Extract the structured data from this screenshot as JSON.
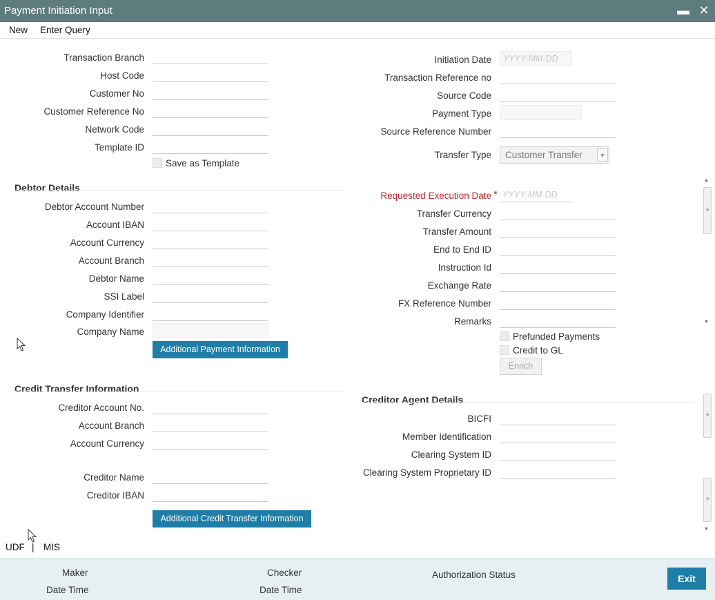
{
  "window": {
    "title": "Payment Initiation Input",
    "minimize": "▬",
    "close": "✕"
  },
  "menu": {
    "new": "New",
    "enter_query": "Enter Query"
  },
  "header_left": {
    "transaction_branch": "Transaction Branch",
    "host_code": "Host Code",
    "customer_no": "Customer No",
    "customer_reference_no": "Customer Reference No",
    "network_code": "Network Code",
    "template_id": "Template ID",
    "save_as_template": "Save as Template"
  },
  "header_right": {
    "initiation_date": "Initiation Date",
    "date_placeholder": "YYYY-MM-DD",
    "transaction_reference_no": "Transaction Reference no",
    "source_code": "Source Code",
    "payment_type": "Payment Type",
    "source_reference_number": "Source Reference Number",
    "transfer_type": "Transfer Type",
    "transfer_type_value": "Customer Transfer"
  },
  "debtor": {
    "section_title": "Debtor Details",
    "debtor_account_number": "Debtor Account Number",
    "account_iban": "Account IBAN",
    "account_currency": "Account Currency",
    "account_branch": "Account Branch",
    "debtor_name": "Debtor Name",
    "ssi_label": "SSI Label",
    "company_identifier": "Company Identifier",
    "company_name": "Company Name",
    "additional_payment_info_button": "Additional Payment Information"
  },
  "transfer": {
    "requested_execution_date": "Requested Execution Date",
    "required_marker": "*",
    "date_placeholder": "YYYY-MM-DD",
    "transfer_currency": "Transfer Currency",
    "transfer_amount": "Transfer Amount",
    "end_to_end_id": "End to End ID",
    "instruction_id": "Instruction Id",
    "exchange_rate": "Exchange Rate",
    "fx_reference_number": "FX Reference Number",
    "remarks": "Remarks",
    "prefunded_payments": "Prefunded Payments",
    "credit_to_gl": "Credit to GL",
    "enrich_button": "Enrich"
  },
  "credit_transfer": {
    "section_title": "Credit Transfer Information",
    "creditor_account_no": "Creditor Account No.",
    "account_branch": "Account Branch",
    "account_currency": "Account Currency",
    "creditor_name": "Creditor Name",
    "creditor_iban": "Creditor IBAN",
    "additional_credit_info_button": "Additional Credit Transfer Information"
  },
  "creditor_agent": {
    "section_title": "Creditor Agent Details",
    "bicfi": "BICFI",
    "member_identification": "Member Identification",
    "clearing_system_id": "Clearing System ID",
    "clearing_system_proprietary_id": "Clearing System Proprietary ID"
  },
  "tabs": {
    "udf": "UDF",
    "separator": "|",
    "mis": "MIS"
  },
  "footer": {
    "maker": "Maker",
    "maker_date_time": "Date Time",
    "checker": "Checker",
    "checker_date_time": "Date Time",
    "authorization_status": "Authorization Status",
    "exit_button": "Exit"
  },
  "colors": {
    "titlebar": "#5e7b7d",
    "button": "#1f7ea7",
    "required": "#c0282f",
    "footer": "#e6f0f3"
  }
}
